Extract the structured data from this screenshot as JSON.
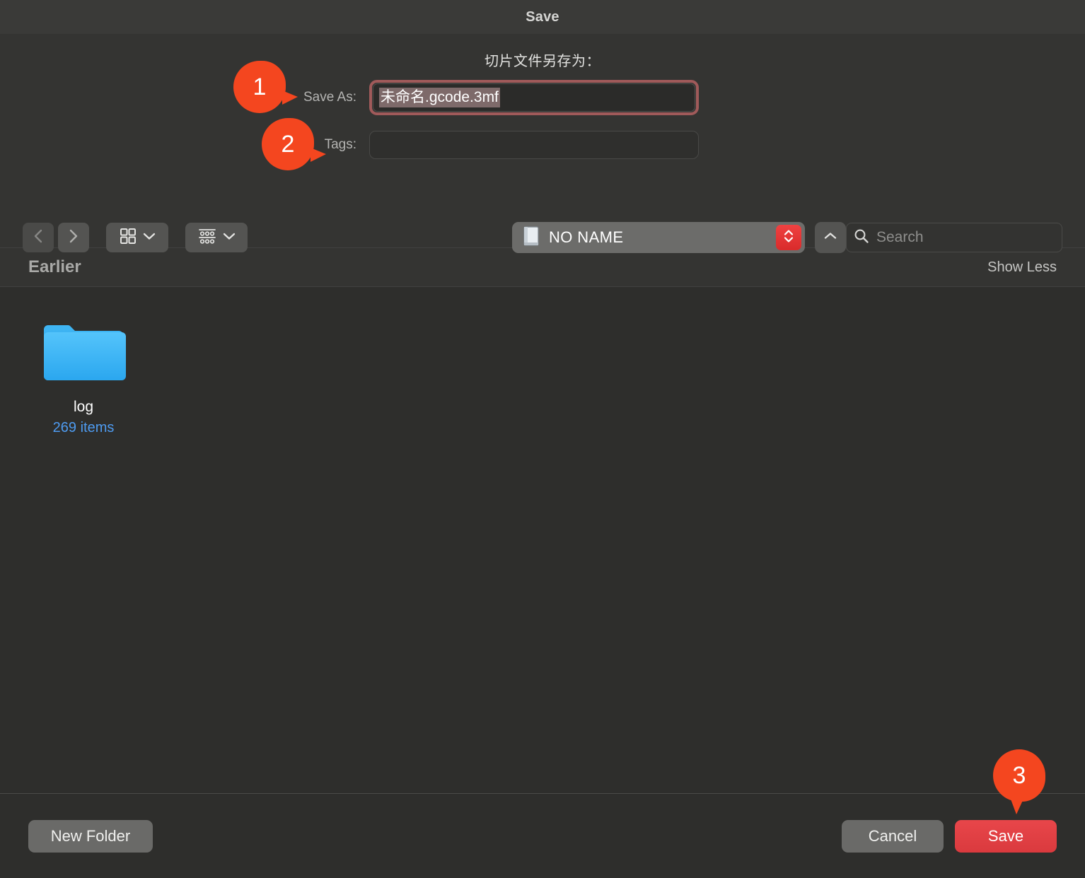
{
  "window": {
    "title": "Save"
  },
  "form": {
    "prompt": "切片文件另存为：",
    "save_as_label": "Save As:",
    "save_as_value": "未命名.gcode.3mf",
    "tags_label": "Tags:",
    "tags_value": "",
    "tags_placeholder": ""
  },
  "toolbar": {
    "back_icon": "chevron-left-icon",
    "forward_icon": "chevron-right-icon",
    "icon_view_icon": "grid-view-icon",
    "group_view_icon": "group-by-icon",
    "location_name": "NO NAME",
    "location_icon": "hard-drive-icon",
    "stepper_icon": "up-down-chevrons-icon",
    "collapse_icon": "chevron-up-icon",
    "search": {
      "icon": "search-icon",
      "placeholder": "Search",
      "value": ""
    }
  },
  "section": {
    "title": "Earlier",
    "action_label": "Show Less"
  },
  "files": [
    {
      "name": "log",
      "meta": "269 items",
      "icon": "folder-icon"
    }
  ],
  "buttons": {
    "new_folder": "New Folder",
    "cancel": "Cancel",
    "save": "Save"
  },
  "annotations": [
    {
      "number": "1",
      "target": "save-as-field"
    },
    {
      "number": "2",
      "target": "tags-field"
    },
    {
      "number": "3",
      "target": "save-button"
    }
  ],
  "colors": {
    "accent_red": "#e8464a",
    "annotation_orange": "#f4461f",
    "link_blue": "#4e9bf0",
    "folder_blue": "#41b6f5",
    "window_bg": "#2e2e2c",
    "titlebar_bg": "#3a3a38"
  }
}
